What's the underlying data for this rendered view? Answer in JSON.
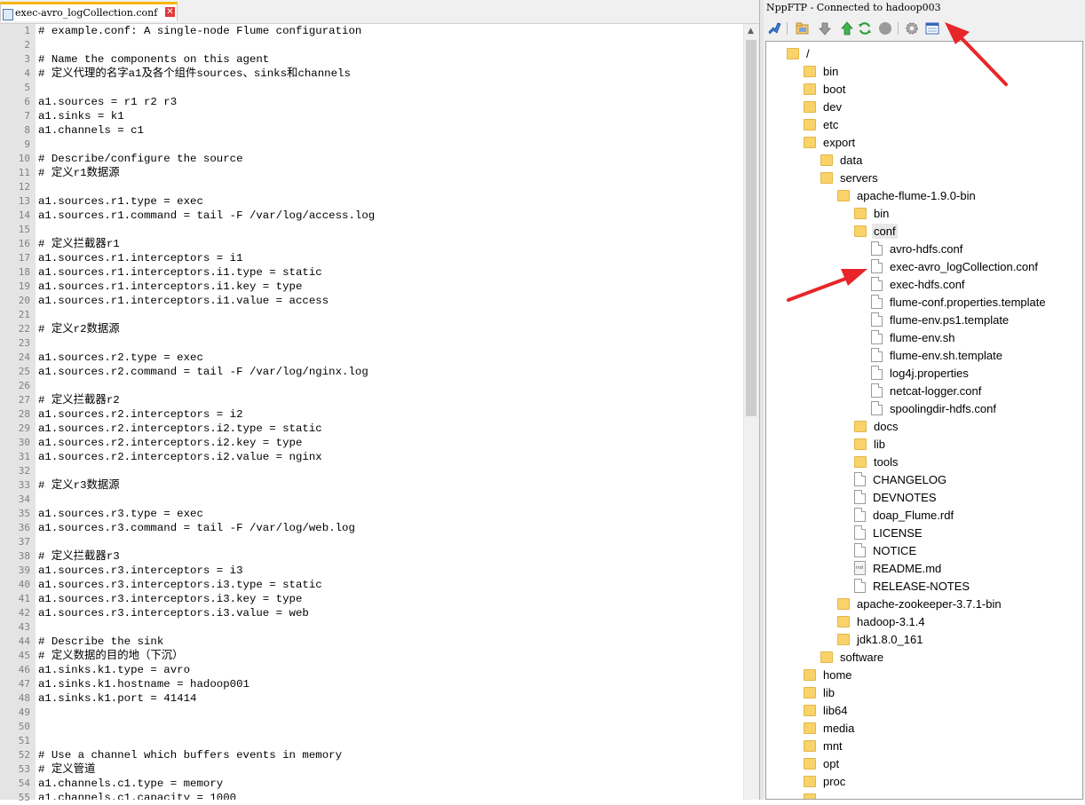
{
  "editor": {
    "tab_label": "exec-avro_logCollection.conf",
    "tab_close": "✕",
    "line_numbers": [
      "1",
      "2",
      "3",
      "4",
      "5",
      "6",
      "7",
      "8",
      "9",
      "10",
      "11",
      "12",
      "13",
      "14",
      "15",
      "16",
      "17",
      "18",
      "19",
      "20",
      "21",
      "22",
      "23",
      "24",
      "25",
      "26",
      "27",
      "28",
      "29",
      "30",
      "31",
      "32",
      "33",
      "34",
      "35",
      "36",
      "37",
      "38",
      "39",
      "40",
      "41",
      "42",
      "43",
      "44",
      "45",
      "46",
      "47",
      "48",
      "49",
      "50",
      "51",
      "52",
      "53",
      "54",
      "55"
    ],
    "lines": [
      "# example.conf: A single-node Flume configuration",
      "",
      "# Name the components on this agent",
      "# 定义代理的名字a1及各个组件sources、sinks和channels",
      "",
      "a1.sources = r1 r2 r3",
      "a1.sinks = k1",
      "a1.channels = c1",
      "",
      "# Describe/configure the source",
      "# 定义r1数据源",
      "",
      "a1.sources.r1.type = exec",
      "a1.sources.r1.command = tail -F /var/log/access.log",
      "",
      "# 定义拦截器r1",
      "a1.sources.r1.interceptors = i1",
      "a1.sources.r1.interceptors.i1.type = static",
      "a1.sources.r1.interceptors.i1.key = type",
      "a1.sources.r1.interceptors.i1.value = access",
      "",
      "# 定义r2数据源",
      "",
      "a1.sources.r2.type = exec",
      "a1.sources.r2.command = tail -F /var/log/nginx.log",
      "",
      "# 定义拦截器r2",
      "a1.sources.r2.interceptors = i2",
      "a1.sources.r2.interceptors.i2.type = static",
      "a1.sources.r2.interceptors.i2.key = type",
      "a1.sources.r2.interceptors.i2.value = nginx",
      "",
      "# 定义r3数据源",
      "",
      "a1.sources.r3.type = exec",
      "a1.sources.r3.command = tail -F /var/log/web.log",
      "",
      "# 定义拦截器r3",
      "a1.sources.r3.interceptors = i3",
      "a1.sources.r3.interceptors.i3.type = static",
      "a1.sources.r3.interceptors.i3.key = type",
      "a1.sources.r3.interceptors.i3.value = web",
      "",
      "# Describe the sink",
      "# 定义数据的目的地（下沉）",
      "a1.sinks.k1.type = avro",
      "a1.sinks.k1.hostname = hadoop001",
      "a1.sinks.k1.port = 41414",
      "",
      "",
      "",
      "# Use a channel which buffers events in memory",
      "# 定义管道",
      "a1.channels.c1.type = memory",
      "a1.channels.c1.capacity = 1000"
    ]
  },
  "ftp": {
    "title": "NppFTP - Connected to hadoop003",
    "toolbar": [
      {
        "icon": "connect-icon"
      },
      {
        "icon": "open-directory-icon"
      },
      {
        "icon": "download-icon"
      },
      {
        "icon": "upload-icon"
      },
      {
        "icon": "refresh-icon"
      },
      {
        "icon": "abort-icon"
      },
      {
        "icon": "settings-icon"
      },
      {
        "icon": "message-window-icon"
      }
    ],
    "tree": [
      {
        "label": "/",
        "depth": 0,
        "type": "folder"
      },
      {
        "label": "bin",
        "depth": 1,
        "type": "folder"
      },
      {
        "label": "boot",
        "depth": 1,
        "type": "folder"
      },
      {
        "label": "dev",
        "depth": 1,
        "type": "folder"
      },
      {
        "label": "etc",
        "depth": 1,
        "type": "folder"
      },
      {
        "label": "export",
        "depth": 1,
        "type": "folder"
      },
      {
        "label": "data",
        "depth": 2,
        "type": "folder"
      },
      {
        "label": "servers",
        "depth": 2,
        "type": "folder"
      },
      {
        "label": "apache-flume-1.9.0-bin",
        "depth": 3,
        "type": "folder"
      },
      {
        "label": "bin",
        "depth": 4,
        "type": "folder"
      },
      {
        "label": "conf",
        "depth": 4,
        "type": "folder",
        "selected": true
      },
      {
        "label": "avro-hdfs.conf",
        "depth": 5,
        "type": "file"
      },
      {
        "label": "exec-avro_logCollection.conf",
        "depth": 5,
        "type": "file"
      },
      {
        "label": "exec-hdfs.conf",
        "depth": 5,
        "type": "file"
      },
      {
        "label": "flume-conf.properties.template",
        "depth": 5,
        "type": "file"
      },
      {
        "label": "flume-env.ps1.template",
        "depth": 5,
        "type": "file"
      },
      {
        "label": "flume-env.sh",
        "depth": 5,
        "type": "file"
      },
      {
        "label": "flume-env.sh.template",
        "depth": 5,
        "type": "file"
      },
      {
        "label": "log4j.properties",
        "depth": 5,
        "type": "file"
      },
      {
        "label": "netcat-logger.conf",
        "depth": 5,
        "type": "file"
      },
      {
        "label": "spoolingdir-hdfs.conf",
        "depth": 5,
        "type": "file"
      },
      {
        "label": "docs",
        "depth": 4,
        "type": "folder"
      },
      {
        "label": "lib",
        "depth": 4,
        "type": "folder"
      },
      {
        "label": "tools",
        "depth": 4,
        "type": "folder"
      },
      {
        "label": "CHANGELOG",
        "depth": 4,
        "type": "file"
      },
      {
        "label": "DEVNOTES",
        "depth": 4,
        "type": "file"
      },
      {
        "label": "doap_Flume.rdf",
        "depth": 4,
        "type": "file"
      },
      {
        "label": "LICENSE",
        "depth": 4,
        "type": "file"
      },
      {
        "label": "NOTICE",
        "depth": 4,
        "type": "file"
      },
      {
        "label": "README.md",
        "depth": 4,
        "type": "md"
      },
      {
        "label": "RELEASE-NOTES",
        "depth": 4,
        "type": "file"
      },
      {
        "label": "apache-zookeeper-3.7.1-bin",
        "depth": 3,
        "type": "folder"
      },
      {
        "label": "hadoop-3.1.4",
        "depth": 3,
        "type": "folder"
      },
      {
        "label": "jdk1.8.0_161",
        "depth": 3,
        "type": "folder"
      },
      {
        "label": "software",
        "depth": 2,
        "type": "folder"
      },
      {
        "label": "home",
        "depth": 1,
        "type": "folder"
      },
      {
        "label": "lib",
        "depth": 1,
        "type": "folder"
      },
      {
        "label": "lib64",
        "depth": 1,
        "type": "folder"
      },
      {
        "label": "media",
        "depth": 1,
        "type": "folder"
      },
      {
        "label": "mnt",
        "depth": 1,
        "type": "folder"
      },
      {
        "label": "opt",
        "depth": 1,
        "type": "folder"
      },
      {
        "label": "proc",
        "depth": 1,
        "type": "folder"
      },
      {
        "label": "",
        "depth": 1,
        "type": "folder"
      }
    ]
  },
  "colors": {
    "annotation_arrow": "#e8262a",
    "tab_highlight": "#f7b500",
    "folder": "#f9d26a"
  }
}
